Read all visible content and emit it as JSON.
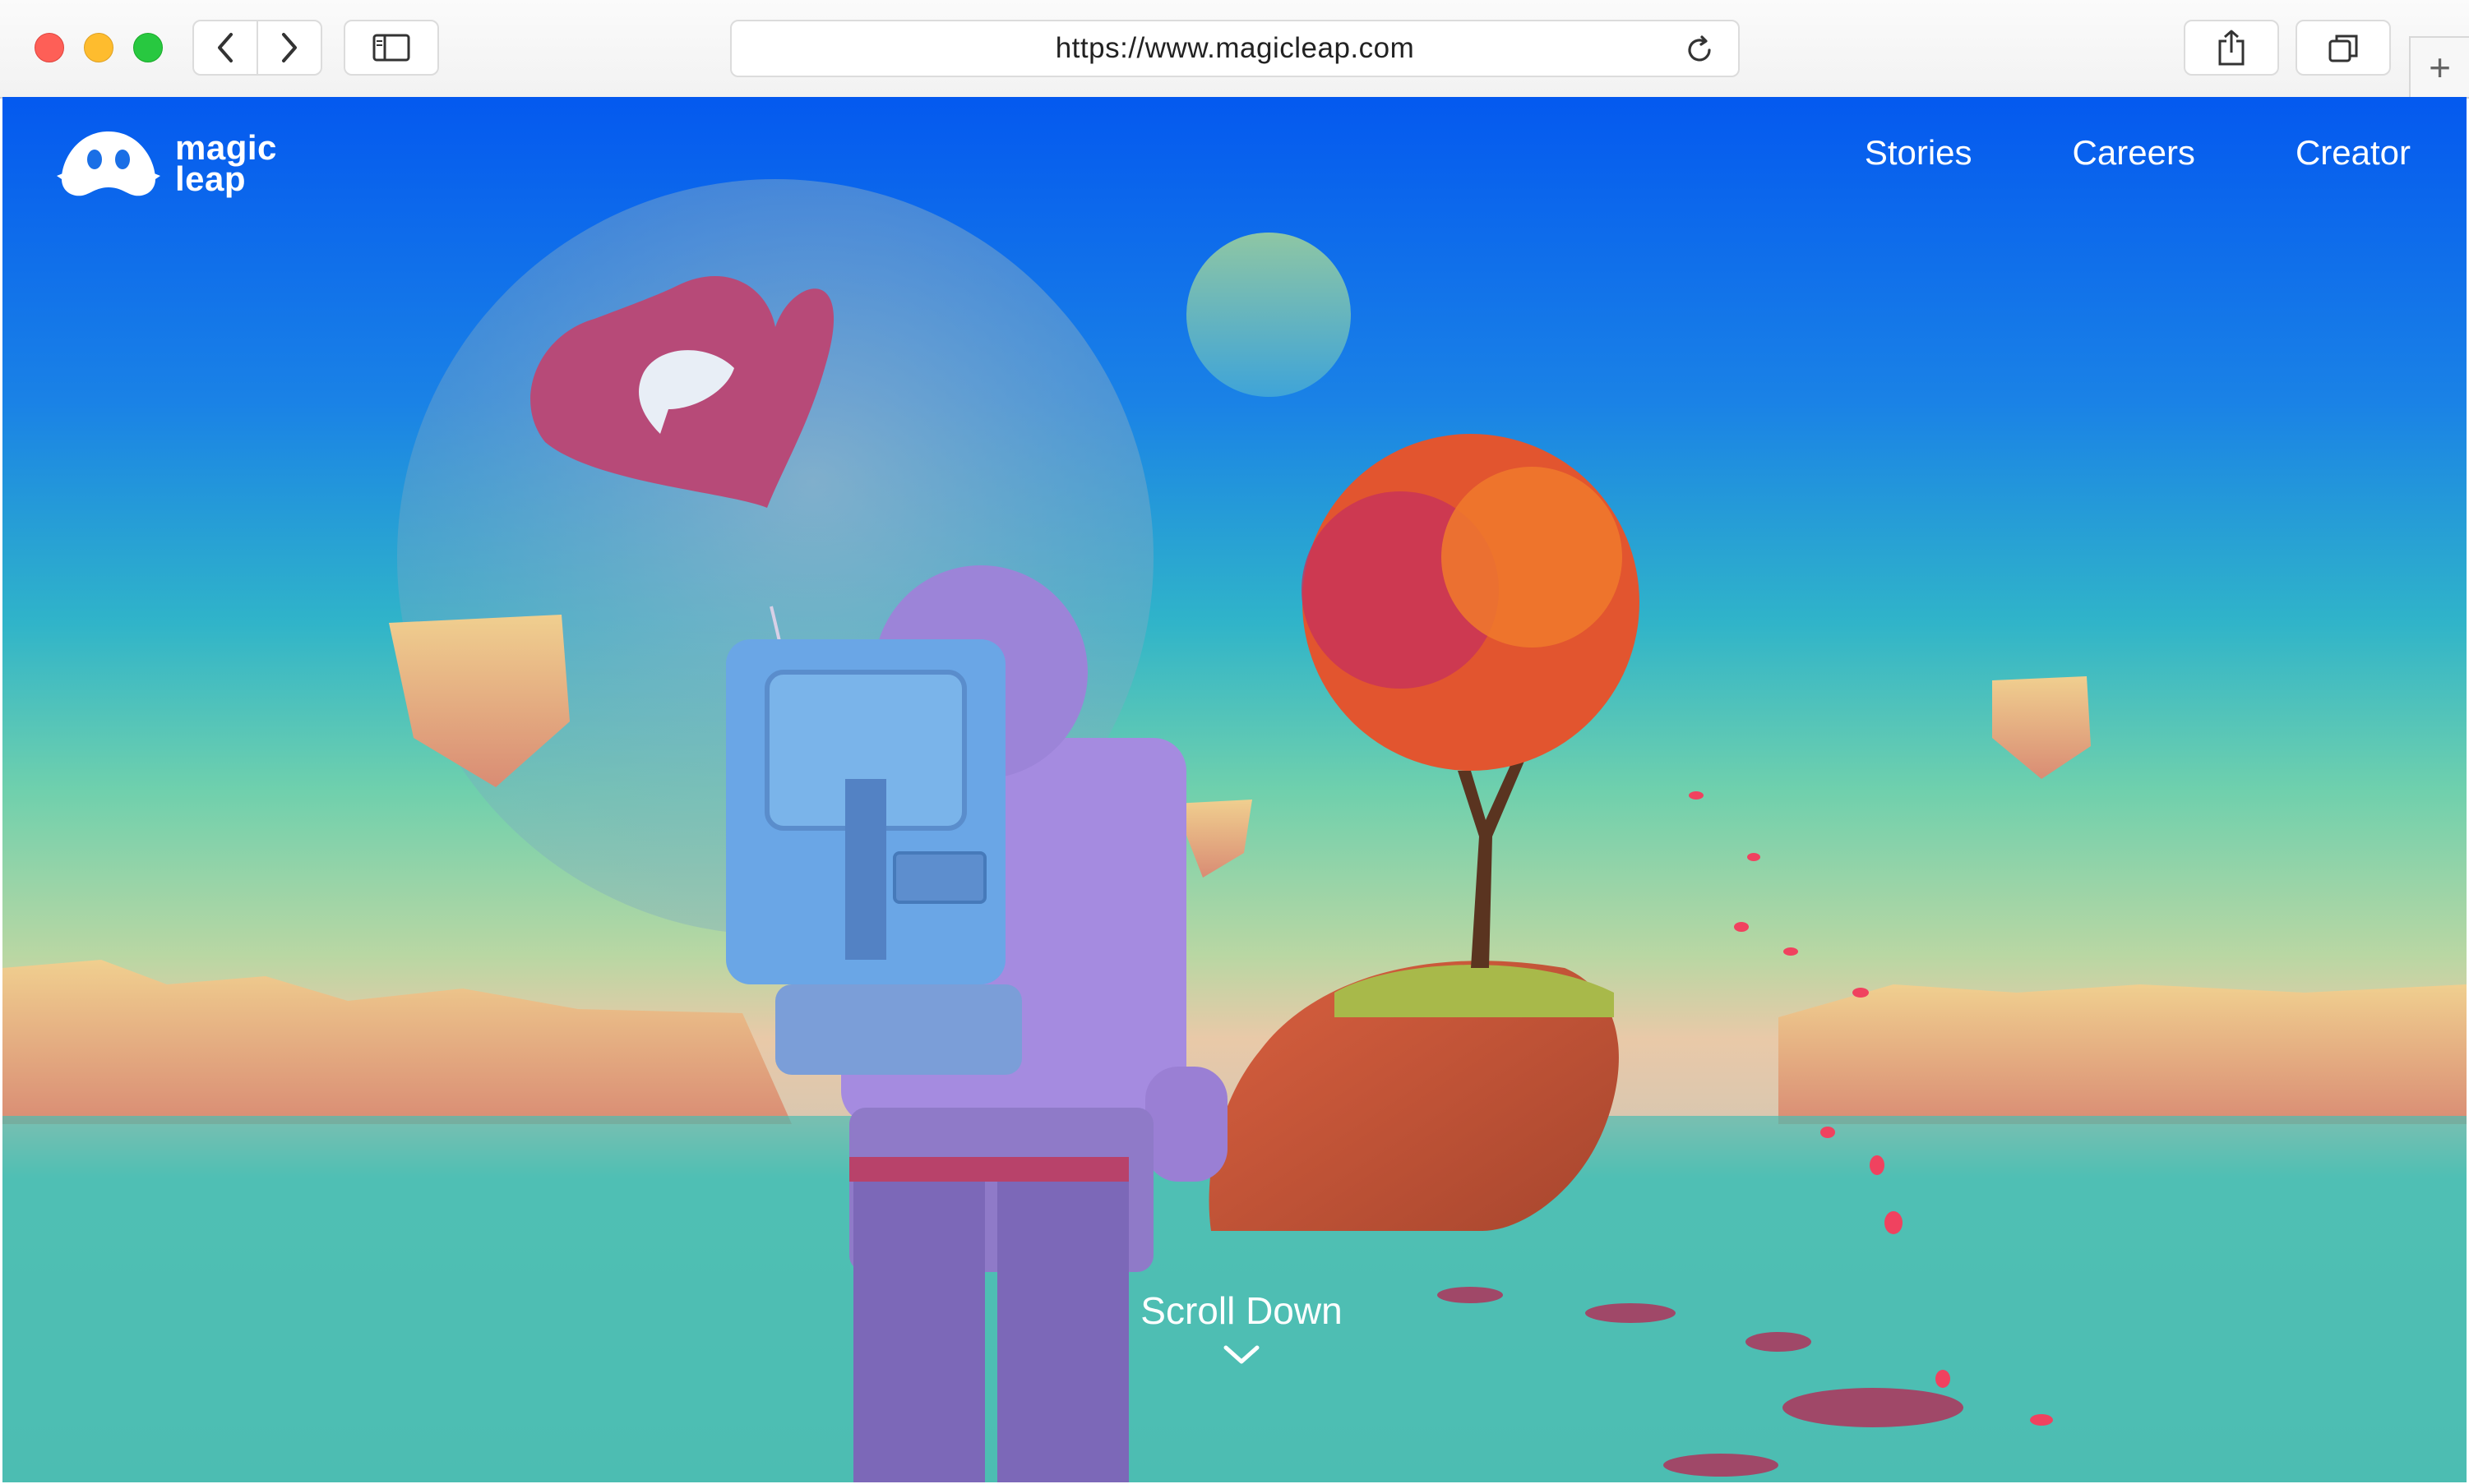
{
  "browser": {
    "url": "https://www.magicleap.com",
    "new_tab_symbol": "+",
    "icons": [
      "back-icon",
      "forward-icon",
      "sidebar-icon",
      "reload-icon",
      "share-icon",
      "tabs-icon",
      "plus-icon"
    ]
  },
  "site": {
    "logo": {
      "line1": "magic",
      "line2": "leap"
    },
    "nav": [
      "Stories",
      "Careers",
      "Creator"
    ],
    "scroll_label": "Scroll Down"
  },
  "colors": {
    "sky_top": "#0459ef",
    "tree_foliage": "#e2552f",
    "astronaut": "#a58be0",
    "balloon": "#b74a78"
  }
}
